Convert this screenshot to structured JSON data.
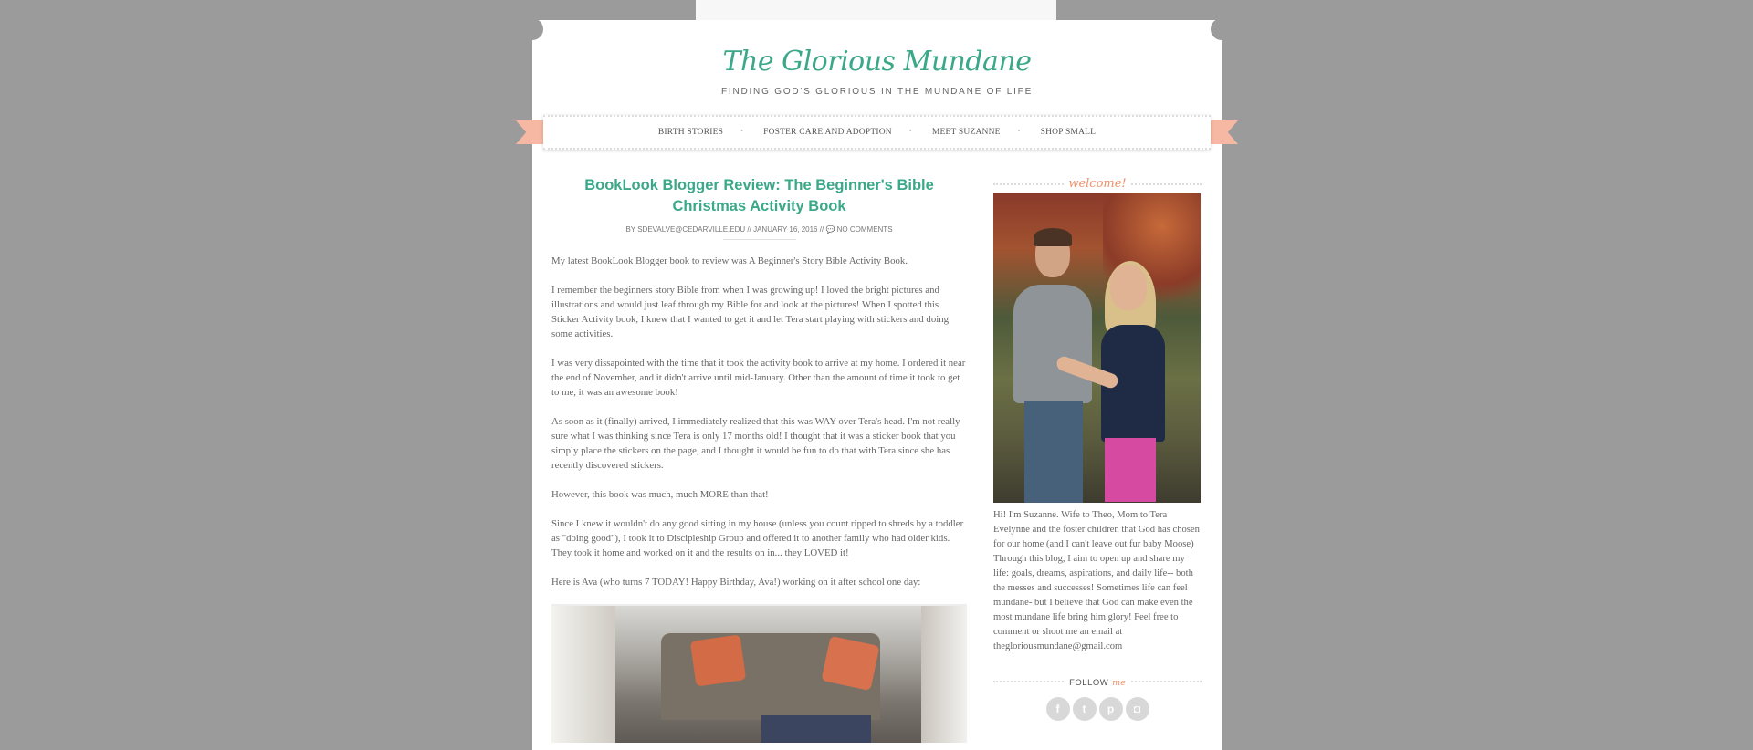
{
  "site": {
    "title": "The Glorious Mundane",
    "tagline": "FINDING GOD'S GLORIOUS IN THE MUNDANE OF LIFE"
  },
  "nav": {
    "items": [
      {
        "label": "BIRTH STORIES"
      },
      {
        "label": "FOSTER CARE AND ADOPTION"
      },
      {
        "label": "MEET SUZANNE"
      },
      {
        "label": "SHOP SMALL"
      }
    ]
  },
  "post": {
    "title": "BookLook Blogger Review: The Beginner's Bible Christmas Activity Book",
    "meta": {
      "by": "BY",
      "author": "SDEVALVE@CEDARVILLE.EDU",
      "sep1": "//",
      "date": "JANUARY 16, 2016",
      "sep2": "//",
      "comments": "NO COMMENTS"
    },
    "paragraphs": [
      "My latest BookLook Blogger book to review was A Beginner's Story Bible Activity Book.",
      "I remember the beginners story Bible from when I was growing up! I loved the bright pictures and illustrations and would just leaf through my Bible for and look at the pictures! When I spotted this Sticker Activity book, I knew that I wanted to get it and let Tera start playing with stickers and doing some activities.",
      "I was very dissapointed with the time that it took the activity book to arrive at my home. I ordered it near the end of November, and it didn't arrive until mid-January. Other than the amount of time it took to get to me, it was an awesome book!",
      "As soon as it (finally) arrived, I immediately realized that this was WAY over Tera's head. I'm not really sure what I was thinking since Tera is only 17 months old! I thought that it was a sticker book that you simply place the stickers on the page, and I thought it would be fun to do that with Tera since she has recently discovered stickers.",
      "However, this book was much, much MORE than that!",
      "Since I knew it wouldn't do any good sitting in my house (unless you count ripped to shreds by a toddler as \"doing good\"), I took it to Discipleship Group and offered it to another family who had older kids. They took it home and worked on it and the results on in... they LOVED it!",
      "Here is Ava (who turns 7 TODAY! Happy Birthday, Ava!) working on it after school one day:"
    ]
  },
  "sidebar": {
    "welcome_heading": "welcome!",
    "about": "Hi! I'm Suzanne. Wife to Theo, Mom to Tera Evelynne and the foster children that God has chosen for our home (and I can't leave out fur baby Moose) Through this blog, I aim to open up and share my life: goals, dreams, aspirations, and daily life-- both the messes and successes! Sometimes life can feel mundane- but I believe that God can make even the most mundane life bring him glory! Feel free to comment or shoot me an email at thegloriousmundane@gmail.com",
    "follow": {
      "word1": "FOLLOW",
      "word2": "me"
    },
    "social": [
      {
        "icon": "facebook-icon",
        "glyph": "f"
      },
      {
        "icon": "twitter-icon",
        "glyph": "t"
      },
      {
        "icon": "pinterest-icon",
        "glyph": "p"
      },
      {
        "icon": "instagram-icon",
        "glyph": "◘"
      }
    ]
  },
  "colors": {
    "accent_green": "#3aa889",
    "accent_peach": "#f09068",
    "ribbon": "#f6b8a2",
    "background": "#9b9b9b"
  }
}
